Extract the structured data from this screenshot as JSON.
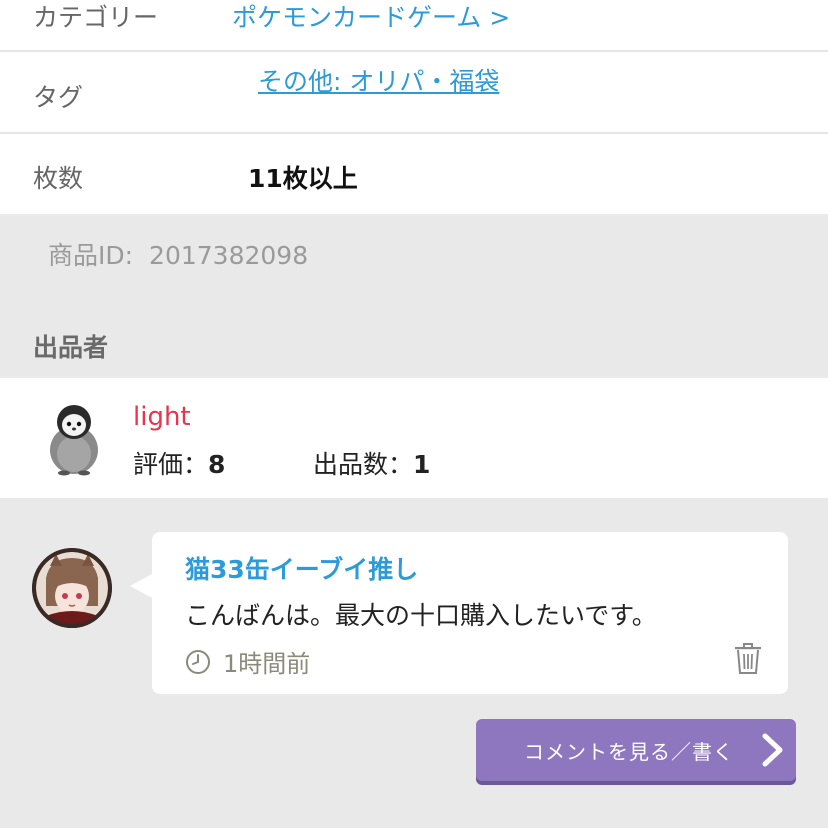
{
  "details": {
    "category_label": "カテゴリー",
    "category_value": "ポケモンカードゲーム >",
    "tag_label": "タグ",
    "tag_value": "その他: オリパ・福袋",
    "count_label": "枚数",
    "count_value": "11枚以上"
  },
  "product": {
    "id_label": "商品ID:",
    "id_value": "2017382098"
  },
  "seller_section": {
    "title": "出品者",
    "name": "light",
    "rating_label": "評価：",
    "rating_value": "8",
    "listings_label": "出品数：",
    "listings_value": "1"
  },
  "comment": {
    "author": "猫33缶イーブイ推し",
    "text": "こんばんは。最大の十口購入したいです。",
    "time": "1時間前"
  },
  "actions": {
    "comment_button_label": "コメントを見る／書く"
  },
  "colors": {
    "link_blue": "#2d9bd8",
    "seller_red": "#e8344e",
    "button_purple": "#8f77c0",
    "background_gray": "#e9e9e9"
  },
  "icons": [
    "penguin-avatar",
    "user-avatar",
    "clock-icon",
    "trash-icon",
    "chevron-right-icon"
  ]
}
